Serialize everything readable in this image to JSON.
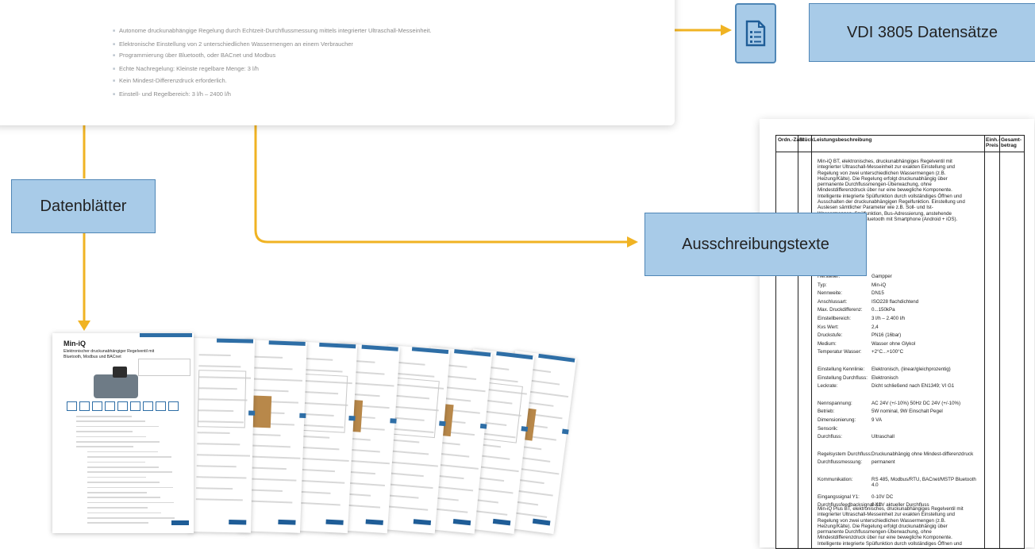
{
  "colors": {
    "connector": "#f0b323",
    "label_fill": "#a8cbe8",
    "label_border": "#4f86b6",
    "brand_blue": "#2e6ea6"
  },
  "labels": {
    "vdi": "VDI 3805 Datensätze",
    "datenblaetter": "Datenblätter",
    "ausschreibung": "Ausschreibungstexte"
  },
  "icons": {
    "doc": "document-list-icon"
  },
  "top_card": {
    "bullets": [
      "Autonome druckunabhängige Regelung durch Echtzeit-Durchflussmessung mittels integrierter Ultraschall-Messeinheit.",
      "Elektronische Einstellung von 2 unterschiedlichen Wassermengen an einem Verbraucher",
      "Programmierung über Bluetooth, oder BACnet und Modbus",
      "Echte Nachregelung: Kleinste regelbare Menge: 3 l/h",
      "Kein Mindest-Differenzdruck erforderlich.",
      "Einstell- und Regelbereich: 3 l/h – 2400 l/h"
    ]
  },
  "text_doc": {
    "headers": [
      "Ordn.-Zahl",
      "Stück",
      "Leistungsbeschreibung",
      "Einh.-Preis",
      "Gesamt-betrag"
    ],
    "intro": "Min-iQ BT, elektronisches, druckunabhängiges Regelventil mit integrierter Ultraschall-Messeinheit zur exakten Einstellung und Regelung von zwei unterschiedlichen Wassermengen (z.B. Heizung/Kälte). Die Regelung erfolgt druckunabhängig über permanente Durchflussmengen-Überwachung, ohne Mindestdifferenzdruck über nur eine bewegliche Komponente. Intelligente integrierte Spülfunktion durch vollständiges Öffnen und Ausschalten der druckunabhängigen Regelfunktion. Einstellung und Auslesen sämtlicher Parameter wie z.B. Soll- und Ist-Wassermengen, Spülfunktion, Bus-Adressierung, anstehende Störungen usw. über Bluetooth mit Smartphone (Android + iOS).",
    "specs": [
      {
        "k": "Hersteller:",
        "v": "Gampper"
      },
      {
        "k": "Typ:",
        "v": "Min-iQ"
      },
      {
        "k": "Nennweite:",
        "v": "DN15"
      },
      {
        "k": "Anschlussart:",
        "v": "ISO228 flachdichtend"
      },
      {
        "k": "Max. Druckdifferenz:",
        "v": "0...150kPa"
      },
      {
        "k": "Einstellbereich:",
        "v": "3 l/h – 2.400 l/h"
      },
      {
        "k": "Kvs Wert:",
        "v": "2,4"
      },
      {
        "k": "Druckstufe:",
        "v": "PN16 (16bar)"
      },
      {
        "k": "Medium:",
        "v": "Wasser ohne Glykol"
      },
      {
        "k": "Temperatur Wasser:",
        "v": "+2°C...+100°C"
      },
      {
        "k": "Einstellung Kennlinie:",
        "v": "Elektronisch, (linear/gleichprozentig)"
      },
      {
        "k": "Einstellung Durchfluss:",
        "v": "Elektronisch"
      },
      {
        "k": "Leckrate:",
        "v": "Dicht schließend nach EN1349; VI G1"
      },
      {
        "k": "Nennspannung:",
        "v": "AC 24V (+/-10%) 50Hz DC 24V (+/-10%)"
      },
      {
        "k": "Betrieb:",
        "v": "5W nominal, 9W Einschalt Pegel"
      },
      {
        "k": "Dimensionierung:",
        "v": "9 VA"
      },
      {
        "k": "Sensorik:",
        "v": ""
      },
      {
        "k": "Durchfluss:",
        "v": "Ultraschall"
      },
      {
        "k": "Regelsystem Durchfluss:",
        "v": "Druckunabhängig ohne Mindest-differenzdruck"
      },
      {
        "k": "Durchflussmessung:",
        "v": "permanent"
      },
      {
        "k": "Kommunikation:",
        "v": "RS 485, Modbus/RTU, BACnet/MSTP Bluetooth 4.0"
      },
      {
        "k": "Eingangssignal Y1:",
        "v": "0-10V DC"
      },
      {
        "k": "Durchflussfeedbacksignal X1:",
        "v": "0-10V aktueller Durchfluss"
      }
    ],
    "outro": "Min-iQ Plus BT, elektronisches, druckunabhängiges Regelventil mit integrierter Ultraschall-Messeinheit zur exakten Einstellung und Regelung von zwei unterschiedlichen Wassermengen (z.B. Heizung/Kälte). Die Regelung erfolgt druckunabhängig über permanente Durchflussmengen-Überwachung, ohne Mindestdifferenzdruck über nur eine bewegliche Komponente. Intelligente integrierte Spülfunktion durch vollständiges Öffnen und"
  },
  "datasheet": {
    "title": "Min-iQ",
    "subtitle": "Elektronischer druckunabhängiger Regelventil mit Bluetooth, Modbus und BACnet",
    "logo": "Gampper"
  }
}
